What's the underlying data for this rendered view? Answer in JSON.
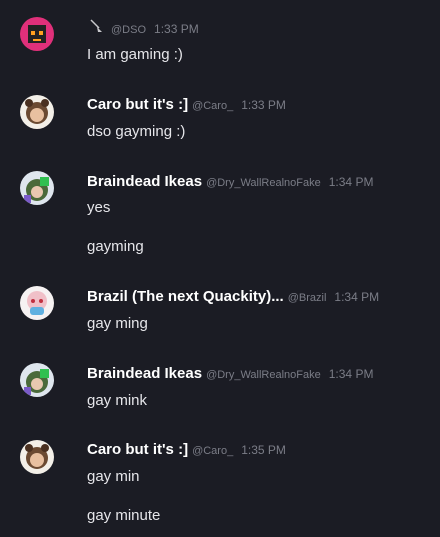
{
  "messages": [
    {
      "name": "",
      "handle": "@DSO",
      "time": "1:33 PM",
      "lines": [
        "I am gaming :)"
      ]
    },
    {
      "name": "Caro but it's :]",
      "handle": "@Caro_",
      "time": "1:33 PM",
      "lines": [
        "dso gayming :)"
      ]
    },
    {
      "name": "Braindead Ikeas",
      "handle": "@Dry_WallRealnoFake",
      "time": "1:34 PM",
      "lines": [
        "yes",
        "gayming"
      ]
    },
    {
      "name": "Brazil (The next Quackity)...",
      "handle": "@Brazil",
      "time": "1:34 PM",
      "lines": [
        "gay ming"
      ]
    },
    {
      "name": "Braindead Ikeas",
      "handle": "@Dry_WallRealnoFake",
      "time": "1:34 PM",
      "lines": [
        "gay mink"
      ]
    },
    {
      "name": "Caro but it's :]",
      "handle": "@Caro_",
      "time": "1:35 PM",
      "lines": [
        "gay min",
        "gay minute"
      ]
    }
  ],
  "colors": {
    "background": "#1b1c24",
    "name": "#ffffff",
    "meta": "#7b7d87",
    "text": "#e6e6ea"
  }
}
